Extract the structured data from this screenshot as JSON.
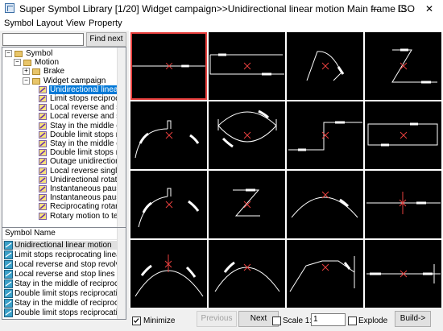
{
  "window": {
    "title": "Super Symbol Library [1/20] Widget campaign>>Unidirectional linear motion Main frame ISO",
    "minimize_glyph": "─",
    "maximize_glyph": "☐",
    "close_glyph": "✕"
  },
  "menu": [
    "Symbol",
    "Layout",
    "View",
    "Property"
  ],
  "search": {
    "value": "",
    "find_next_label": "Find next"
  },
  "tree": {
    "rows": [
      {
        "label": "Symbol",
        "depth": 0,
        "kind": "folder",
        "expanded": true
      },
      {
        "label": "Motion",
        "depth": 1,
        "kind": "folder",
        "expanded": true
      },
      {
        "label": "Brake",
        "depth": 2,
        "kind": "folder",
        "expanded": false
      },
      {
        "label": "Widget campaign",
        "depth": 2,
        "kind": "folder",
        "expanded": true
      },
      {
        "label": "Unidirectional linear m",
        "depth": 3,
        "kind": "symbol",
        "selected": true
      },
      {
        "label": "Limit stops reciprocatin",
        "depth": 3,
        "kind": "symbol"
      },
      {
        "label": "Local reverse and sto",
        "depth": 3,
        "kind": "symbol"
      },
      {
        "label": "Local reverse and sto",
        "depth": 3,
        "kind": "symbol"
      },
      {
        "label": "Stay in the middle of r",
        "depth": 3,
        "kind": "symbol"
      },
      {
        "label": "Double limit stops rec",
        "depth": 3,
        "kind": "symbol"
      },
      {
        "label": "Stay in the middle of r",
        "depth": 3,
        "kind": "symbol"
      },
      {
        "label": "Double limit stops rec",
        "depth": 3,
        "kind": "symbol"
      },
      {
        "label": "Outage unidirectional",
        "depth": 3,
        "kind": "symbol"
      },
      {
        "label": "Local reverse single p",
        "depth": 3,
        "kind": "symbol"
      },
      {
        "label": "Unidirectional rotating",
        "depth": 3,
        "kind": "symbol"
      },
      {
        "label": "Instantaneous pause",
        "depth": 3,
        "kind": "symbol"
      },
      {
        "label": "Instantaneous pause",
        "depth": 3,
        "kind": "symbol"
      },
      {
        "label": "Reciprocating rotary r",
        "depth": 3,
        "kind": "symbol"
      },
      {
        "label": "Rotary motion to term",
        "depth": 3,
        "kind": "symbol"
      }
    ]
  },
  "symbol_list": {
    "header": "Symbol Name",
    "rows": [
      {
        "label": "Unidirectional linear motion",
        "selected": true
      },
      {
        "label": "Limit stops reciprocating linear"
      },
      {
        "label": "Local reverse and stop revolving"
      },
      {
        "label": "Local reverse and stop lines"
      },
      {
        "label": "Stay in the middle of reciprocating Rot"
      },
      {
        "label": "Double limit stops reciprocating rotatio"
      },
      {
        "label": "Stay in the middle of reciprocating linear"
      },
      {
        "label": "Double limit stops reciprocating linear"
      }
    ]
  },
  "bottom": {
    "minimize_label": "Minimize",
    "minimize_checked": true,
    "previous_label": "Previous",
    "next_label": "Next",
    "scale_label": "Scale 1:",
    "scale_checked": false,
    "scale_value": "1",
    "explode_label": "Explode",
    "explode_checked": false,
    "build_label": "Build->"
  },
  "colors": {
    "selection": "#0078d7",
    "tile_background": "#000000",
    "tile_stroke": "#ffffff",
    "center_mark": "#e8403e",
    "tile_selected_border": "#e8403e"
  }
}
